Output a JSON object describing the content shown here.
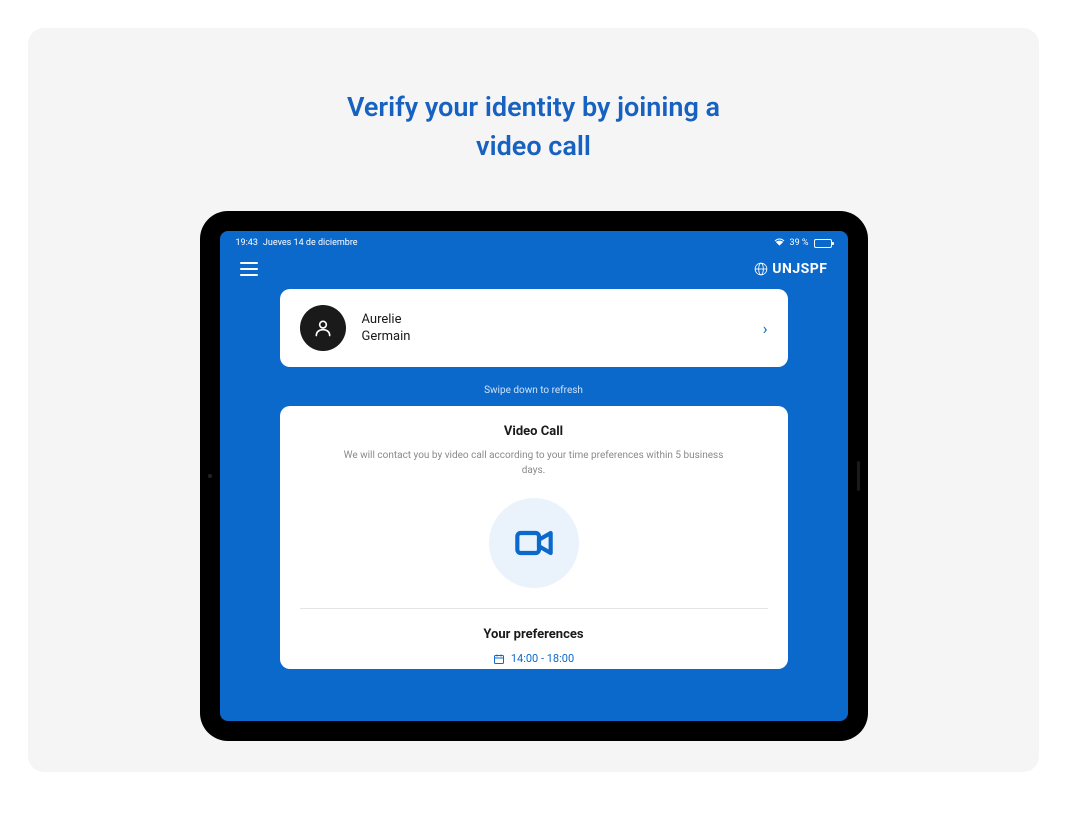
{
  "headline": {
    "line1": "Verify your identity by joining a",
    "line2": "video call"
  },
  "status_bar": {
    "time": "19:43",
    "date": "Jueves 14 de diciembre",
    "battery": "39 %"
  },
  "brand": {
    "name": "UNJSPF"
  },
  "profile": {
    "first_name": "Aurelie",
    "last_name": "Germain"
  },
  "refresh_hint": "Swipe down to refresh",
  "video_call": {
    "title": "Video Call",
    "description": "We will contact you by video call according to your time preferences within 5 business days."
  },
  "preferences": {
    "title": "Your preferences",
    "time_range": "14:00 - 18:00"
  },
  "colors": {
    "primary_blue": "#0c69cc",
    "link_blue": "#1761c0",
    "bg_gray": "#f5f5f5"
  }
}
